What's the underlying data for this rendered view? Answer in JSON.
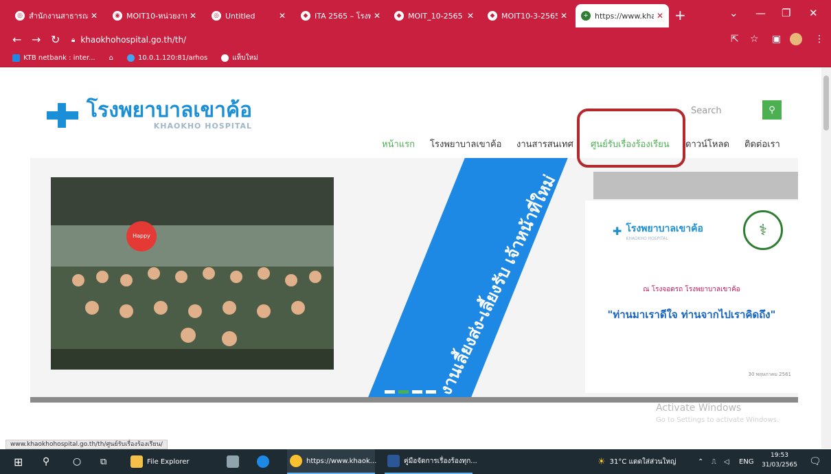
{
  "browser": {
    "tabs": [
      {
        "title": "สำนักงานสาธารณสุ",
        "icon": "chrome-globe-icon"
      },
      {
        "title": "MOIT10-หน่วยงาน",
        "icon": "moit-icon"
      },
      {
        "title": "Untitled",
        "icon": "chrome-globe-icon"
      },
      {
        "title": "ITA 2565 – โรงพ",
        "icon": "ita-icon"
      },
      {
        "title": "MOIT_10-2565 -",
        "icon": "ita-icon"
      },
      {
        "title": "MOIT10-3-2565",
        "icon": "ita-icon"
      },
      {
        "title": "https://www.kha",
        "icon": "hospital-icon"
      }
    ],
    "url": "khaokhohospital.go.th/th/",
    "bookmarks": [
      "KTB netbank : inter...",
      "10.0.1.120:81/arhos",
      "แท็บใหม่"
    ]
  },
  "site": {
    "logo_th": "โรงพยาบาลเขาค้อ",
    "logo_en": "KHAOKHO HOSPITAL",
    "search_placeholder": "Search",
    "menu": [
      "หน้าแรก",
      "โรงพยาบาลเขาค้อ",
      "งานสารสนเทศ",
      "ศูนย์รับเรื่องร้องเรียน",
      "ดาวน์โหลด",
      "ติดต่อเรา"
    ],
    "slide": {
      "band_text": "งานเลี้ยงส่ง-เลี้ยงรับ เจ้าหน้าที่ใหม่",
      "card_logo_th": "โรงพยาบาลเขาค้อ",
      "card_logo_en": "KHAOKHO HOSPITAL",
      "card_sub": "ณ โรงจอดรถ โรงพยาบาลเขาค้อ",
      "card_quote": "\"ท่านมาเราดีใจ ท่านจากไปเราคิดถึง\"",
      "card_date": "30 พฤษภาคม 2561",
      "balloon_text": "Happy"
    }
  },
  "windows": {
    "watermark_title": "Activate Windows",
    "watermark_sub": "Go to Settings to activate Windows.",
    "status_url": "www.khaokhohospital.go.th/th/ศูนย์รับเรื่องร้องเรียน/",
    "taskbar": {
      "file_explorer": "File Explorer",
      "chrome": "https://www.khaok...",
      "word": "คู่มือจัดการเรื่องร้องทุก...",
      "weather": "31°C แดดใส่ส่วนใหญ่",
      "lang": "ENG",
      "time": "19:53",
      "date": "31/03/2565"
    }
  },
  "colors": {
    "chrome": "#c9203f",
    "brand_blue": "#1a8fd8",
    "brand_green": "#4caf50",
    "highlight": "#b3282d"
  }
}
